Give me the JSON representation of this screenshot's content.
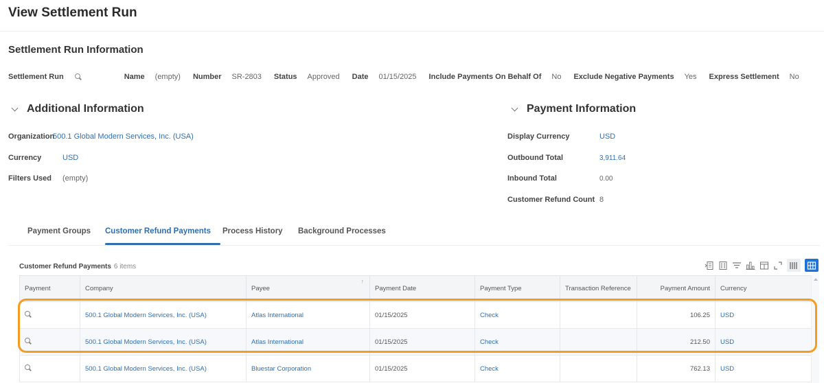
{
  "page": {
    "title": "View Settlement Run"
  },
  "settlement_info": {
    "title": "Settlement Run Information",
    "settlement_run_label": "Settlement Run",
    "fields": [
      {
        "label": "Name",
        "value": "(empty)"
      },
      {
        "label": "Number",
        "value": "SR-2803"
      },
      {
        "label": "Status",
        "value": "Approved"
      },
      {
        "label": "Date",
        "value": "01/15/2025"
      },
      {
        "label": "Include Payments On Behalf Of",
        "value": "No"
      },
      {
        "label": "Exclude Negative Payments",
        "value": "Yes"
      },
      {
        "label": "Express Settlement",
        "value": "No"
      }
    ]
  },
  "additional_info": {
    "title": "Additional Information",
    "organization_label": "Organization",
    "organization_value": "500.1 Global Modern Services, Inc. (USA)",
    "currency_label": "Currency",
    "currency_value": "USD",
    "filters_label": "Filters Used",
    "filters_value": "(empty)"
  },
  "payment_info": {
    "title": "Payment Information",
    "display_currency_label": "Display Currency",
    "display_currency_value": "USD",
    "outbound_label": "Outbound Total",
    "outbound_value": "3,911.64",
    "inbound_label": "Inbound Total",
    "inbound_value": "0.00",
    "refund_count_label": "Customer Refund Count",
    "refund_count_value": "8"
  },
  "tabs": [
    {
      "label": "Payment Groups",
      "active": false
    },
    {
      "label": "Customer Refund Payments",
      "active": true
    },
    {
      "label": "Process History",
      "active": false
    },
    {
      "label": "Background Processes",
      "active": false
    }
  ],
  "grid": {
    "title": "Customer Refund Payments",
    "count": "6 items",
    "toolbar_icons": [
      "export-excel-icon",
      "export-pdf-icon",
      "filter-icon",
      "chart-icon",
      "column-config-icon",
      "fullscreen-icon",
      "table-view-icon",
      "grid-view-icon"
    ],
    "columns": [
      "Payment",
      "Company",
      "Payee",
      "Payment Date",
      "Payment Type",
      "Transaction Reference",
      "Payment Amount",
      "Currency"
    ],
    "sort_indicator": "↑",
    "rows": [
      {
        "company": "500.1 Global Modern Services, Inc. (USA)",
        "payee": "Atlas International",
        "date": "01/15/2025",
        "type": "Check",
        "reference": "",
        "amount": "106.25",
        "currency": "USD"
      },
      {
        "company": "500.1 Global Modern Services, Inc. (USA)",
        "payee": "Atlas International",
        "date": "01/15/2025",
        "type": "Check",
        "reference": "",
        "amount": "212.50",
        "currency": "USD"
      },
      {
        "company": "500.1 Global Modern Services, Inc. (USA)",
        "payee": "Bluestar Corporation",
        "date": "01/15/2025",
        "type": "Check",
        "reference": "",
        "amount": "762.13",
        "currency": "USD"
      }
    ]
  },
  "highlight_color": "#f39c1f",
  "accent_color": "#2f6fb1"
}
